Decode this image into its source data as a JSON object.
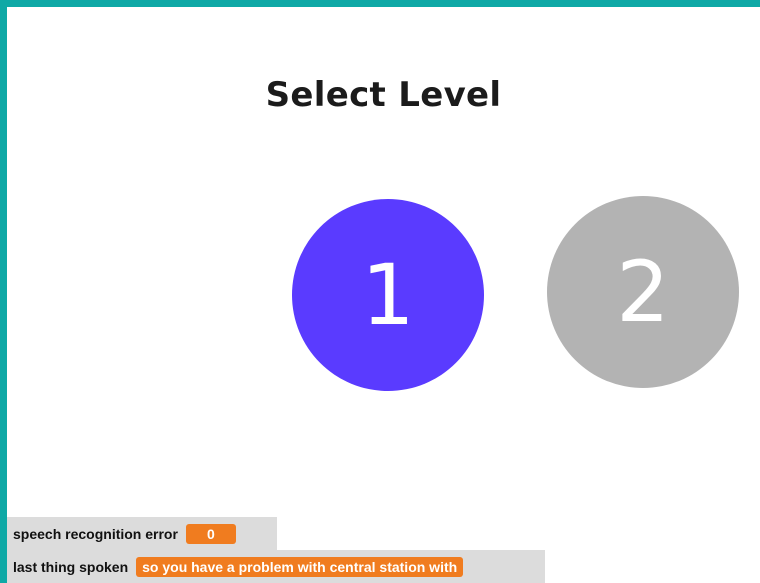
{
  "title": "Select Level",
  "levels": [
    {
      "label": "1",
      "color": "#5a3bff",
      "state": "active"
    },
    {
      "label": "2",
      "color": "#b3b3b3",
      "state": "inactive"
    }
  ],
  "monitors": {
    "speech_error": {
      "label": "speech recognition error",
      "value": "0"
    },
    "last_spoken": {
      "label": "last thing spoken",
      "value": "so you have a problem with central station with"
    }
  },
  "colors": {
    "frame": "#0fa9a6",
    "monitor_value": "#f07c1f"
  }
}
